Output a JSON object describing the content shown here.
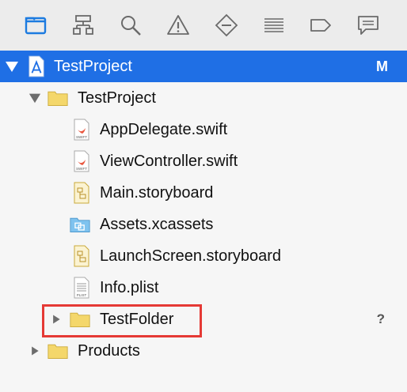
{
  "toolbar": {
    "icons": [
      "folder-icon",
      "hierarchy-icon",
      "search-icon",
      "warning-icon",
      "diamond-minus-icon",
      "list-icon",
      "tag-icon",
      "chat-icon"
    ]
  },
  "tree": {
    "project": {
      "label": "TestProject",
      "badge": "M"
    },
    "group": {
      "label": "TestProject"
    },
    "files": [
      {
        "label": "AppDelegate.swift",
        "type": "swift"
      },
      {
        "label": "ViewController.swift",
        "type": "swift"
      },
      {
        "label": "Main.storyboard",
        "type": "storyboard"
      },
      {
        "label": "Assets.xcassets",
        "type": "assets"
      },
      {
        "label": "LaunchScreen.storyboard",
        "type": "storyboard"
      },
      {
        "label": "Info.plist",
        "type": "plist"
      }
    ],
    "test_folder": {
      "label": "TestFolder",
      "badge": "?"
    },
    "products": {
      "label": "Products"
    }
  },
  "colors": {
    "selection": "#1f6fe5",
    "highlight_border": "#e53935",
    "folder_yellow": "#f4d76b",
    "swift_orange": "#e9573f"
  }
}
